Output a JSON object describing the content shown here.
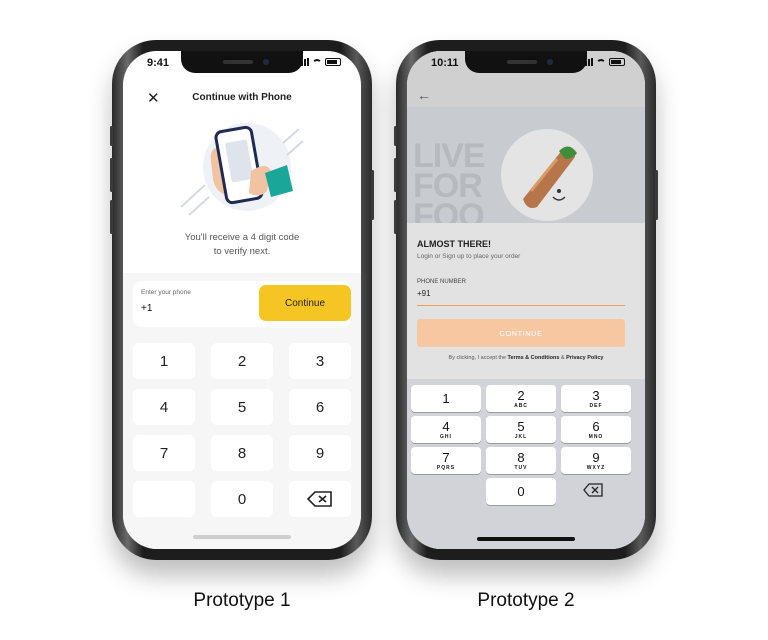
{
  "prototype1": {
    "status_time": "9:41",
    "header_title": "Continue with Phone",
    "close_glyph": "✕",
    "receive_line1": "You'll receive a 4 digit code",
    "receive_line2": "to verify next.",
    "phone_label": "Enter your phone",
    "country_code": "+1",
    "continue_label": "Continue",
    "keys": [
      "1",
      "2",
      "3",
      "4",
      "5",
      "6",
      "7",
      "8",
      "9",
      "",
      "0",
      "⌫"
    ],
    "accent_color": "#f5c623"
  },
  "prototype2": {
    "status_time": "10:11",
    "back_glyph": "←",
    "banner_text_line1": "LIVE",
    "banner_text_line2": "FOR",
    "banner_text_line3": "FOO",
    "title": "ALMOST THERE!",
    "subtitle": "Login or Sign up to place your order",
    "phone_label": "PHONE NUMBER",
    "country_code": "+91",
    "continue_label": "CONTINUE",
    "terms_prefix": "By clicking, I accept the ",
    "terms_link": "Terms & Conditions",
    "terms_amp": " & ",
    "privacy_link": "Privacy Policy",
    "keys": [
      {
        "digit": "1",
        "letters": ""
      },
      {
        "digit": "2",
        "letters": "ABC"
      },
      {
        "digit": "3",
        "letters": "DEF"
      },
      {
        "digit": "4",
        "letters": "GHI"
      },
      {
        "digit": "5",
        "letters": "JKL"
      },
      {
        "digit": "6",
        "letters": "MNO"
      },
      {
        "digit": "7",
        "letters": "PQRS"
      },
      {
        "digit": "8",
        "letters": "TUV"
      },
      {
        "digit": "9",
        "letters": "WXYZ"
      },
      {
        "digit": "0",
        "letters": ""
      }
    ],
    "accent_color": "#f7c7a2"
  },
  "captions": {
    "left": "Prototype 1",
    "right": "Prototype 2"
  }
}
